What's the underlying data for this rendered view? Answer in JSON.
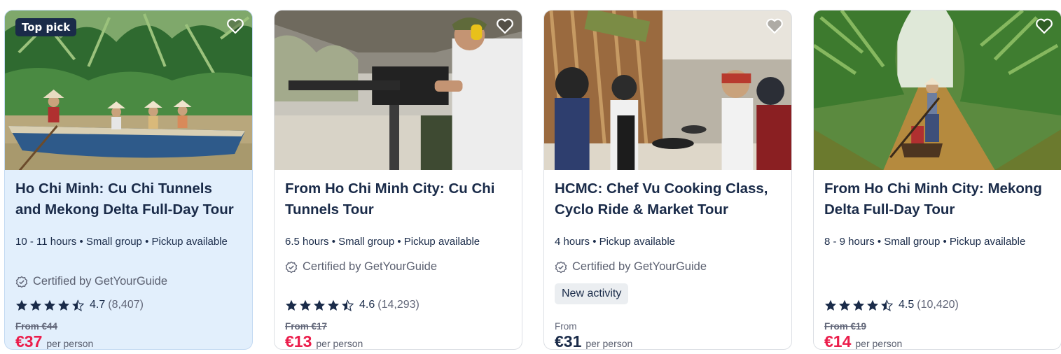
{
  "cards": [
    {
      "badge": "Top pick",
      "title": "Ho Chi Minh: Cu Chi Tunnels and Mekong Delta Full-Day Tour",
      "meta": "10 - 11 hours • Small group • Pickup available",
      "certified": "Certified by GetYourGuide",
      "rating": "4.7",
      "reviews": "(8,407)",
      "old_price": "From €44",
      "price": "€37",
      "per": "per person",
      "image": "mekong-boat-palms"
    },
    {
      "title": "From Ho Chi Minh City: Cu Chi Tunnels Tour",
      "meta": "6.5 hours • Small group • Pickup available",
      "certified": "Certified by GetYourGuide",
      "rating": "4.6",
      "reviews": "(14,293)",
      "old_price": "From €17",
      "price": "€13",
      "per": "per person",
      "image": "man-with-machine-gun"
    },
    {
      "title": "HCMC: Chef Vu Cooking Class, Cyclo Ride & Market Tour",
      "meta": "4 hours • Pickup available",
      "certified": "Certified by GetYourGuide",
      "badge_new": "New activity",
      "from_label": "From",
      "price": "€31",
      "per": "per person",
      "image": "cooking-class"
    },
    {
      "title": "From Ho Chi Minh City: Mekong Delta Full-Day Tour",
      "meta": "8 - 9 hours • Small group • Pickup available",
      "rating": "4.5",
      "reviews": "(10,420)",
      "old_price": "From €19",
      "price": "€14",
      "per": "per person",
      "image": "mekong-canal-rower"
    }
  ],
  "colors": {
    "navy": "#1a2b49",
    "sale_red": "#eb1d4b",
    "selected_bg": "#e2effc"
  },
  "icons": {
    "wishlist": "heart-outline-icon",
    "certified": "badge-check-icon",
    "star": "star-icon"
  }
}
